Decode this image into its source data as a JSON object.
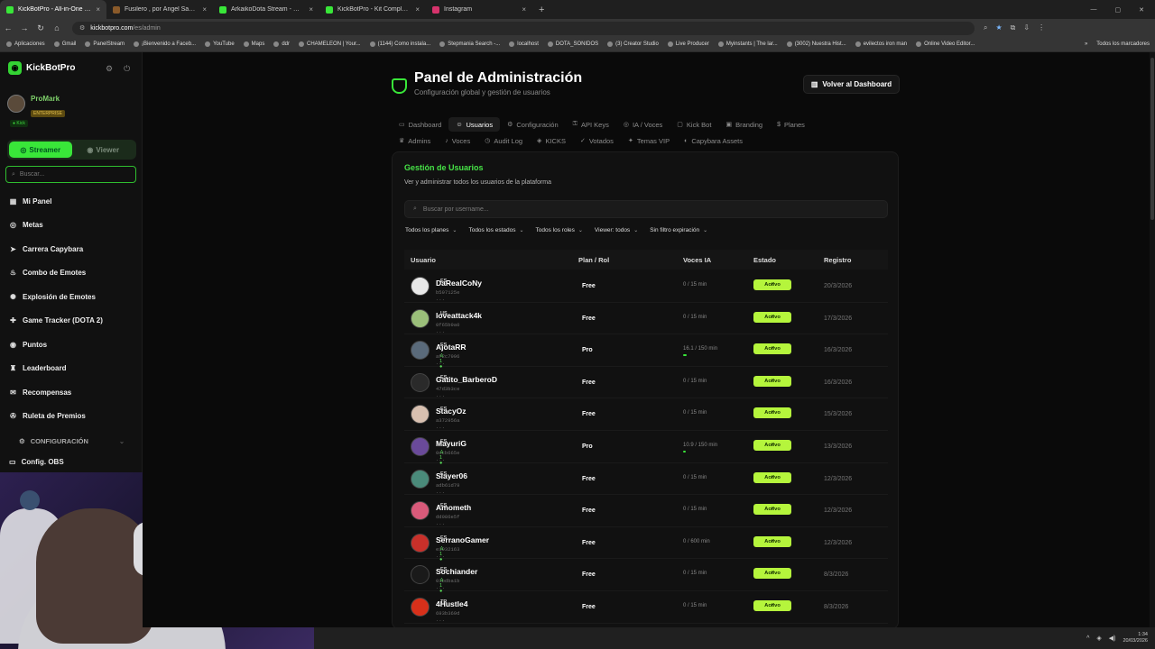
{
  "browser": {
    "tabs": [
      {
        "title": "KickBotPro - All-in-One Stream",
        "color": "#39e639",
        "active": true
      },
      {
        "title": "Fusilero , por Ángel Sacristán",
        "color": "#8a5a2a",
        "active": false
      },
      {
        "title": "ArkaikoDota Stream - Watch Li",
        "color": "#39e639",
        "active": false
      },
      {
        "title": "KickBotPro - Kit Completo de S",
        "color": "#39e639",
        "active": false
      },
      {
        "title": "Instagram",
        "color": "#d6336c",
        "active": false
      }
    ],
    "url_host": "kickbotpro.com",
    "url_path": "/es/admin",
    "bookmarks": [
      "Aplicaciones",
      "Gmail",
      "PanelStream",
      "¡Bienvenido a Faceb...",
      "YouTube",
      "Maps",
      "ddr",
      "CHAMELEON | Your...",
      "(1144) Como instala...",
      "Stepmania Search -...",
      "localhost",
      "DOTA_SONIDOS",
      "(3) Creator Studio",
      "Live Producer",
      "Myinstants | The lar...",
      "(3002) Nuestra Hist...",
      "evilectos iron man",
      "Online Video Editor..."
    ],
    "bookmarks_all": "Todos los marcadores"
  },
  "sidebar": {
    "brand": "KickBotPro",
    "user_name": "ProMark",
    "user_plan": "ENTERPRISE",
    "platform": "Kick",
    "mode_on": "Streamer",
    "mode_off": "Viewer",
    "search_placeholder": "Buscar...",
    "items": [
      {
        "label": "Mi Panel",
        "icon": "grid"
      },
      {
        "label": "Metas",
        "icon": "target"
      },
      {
        "label": "Carrera Capybara",
        "icon": "race"
      },
      {
        "label": "Combo de Emotes",
        "icon": "flame"
      },
      {
        "label": "Explosión de Emotes",
        "icon": "burst"
      },
      {
        "label": "Game Tracker (DOTA 2)",
        "icon": "gamepad"
      },
      {
        "label": "Puntos",
        "icon": "coin"
      },
      {
        "label": "Leaderboard",
        "icon": "trophy"
      },
      {
        "label": "Recompensas",
        "icon": "gift"
      },
      {
        "label": "Ruleta de Premios",
        "icon": "wheel"
      }
    ],
    "config_label": "CONFIGURACIÓN",
    "obs_label": "Config. OBS"
  },
  "page": {
    "title": "Panel de Administración",
    "subtitle": "Configuración global y gestión de usuarios",
    "back_button": "Volver al Dashboard",
    "tabs_row1": [
      {
        "label": "Dashboard",
        "icon": "▭",
        "active": false
      },
      {
        "label": "Usuarios",
        "icon": "☺",
        "active": true
      },
      {
        "label": "Configuración",
        "icon": "⚙",
        "active": false
      },
      {
        "label": "API Keys",
        "icon": "⚿",
        "active": false
      },
      {
        "label": "IA / Voces",
        "icon": "◎",
        "active": false
      },
      {
        "label": "Kick Bot",
        "icon": "▢",
        "active": false
      },
      {
        "label": "Branding",
        "icon": "▣",
        "active": false
      },
      {
        "label": "Planes",
        "icon": "$",
        "active": false
      }
    ],
    "tabs_row2": [
      {
        "label": "Admins",
        "icon": "♛",
        "active": false
      },
      {
        "label": "Voces",
        "icon": "♪",
        "active": false
      },
      {
        "label": "Audit Log",
        "icon": "◷",
        "active": false
      },
      {
        "label": "KICKS",
        "icon": "◈",
        "active": false
      },
      {
        "label": "Votados",
        "icon": "✓",
        "active": false
      },
      {
        "label": "Temas VIP",
        "icon": "✦",
        "active": false
      },
      {
        "label": "Capybara Assets",
        "icon": "◐",
        "active": false
      }
    ],
    "card_title": "Gestión de Usuarios",
    "card_subtitle": "Ver y administrar todos los usuarios de la plataforma",
    "search_placeholder": "Buscar por username...",
    "filters": [
      "Todos los planes",
      "Todos los estados",
      "Todos los roles",
      "Viewer: todos",
      "Sin filtro expiración"
    ],
    "columns": [
      "Usuario",
      "Plan / Rol",
      "Voces IA",
      "Estado",
      "Registro"
    ],
    "users": [
      {
        "name": "DaRealCoNy",
        "lang": "ES",
        "id": "b597125e ...",
        "badge": "",
        "plan": "Free",
        "voices": "0 / 15 min",
        "voice_fraction": 0,
        "status": "Activo",
        "date": "20/3/2026",
        "avatar": "#e8e8e8"
      },
      {
        "name": "loveattack4k",
        "lang": "US",
        "id": "0f65b9a0 ...",
        "badge": "",
        "plan": "Free",
        "voices": "0 / 15 min",
        "voice_fraction": 0,
        "status": "Activo",
        "date": "17/3/2026",
        "avatar": "#9bbf7a"
      },
      {
        "name": "AjotaRR",
        "lang": "ES",
        "id": "af2c7996 ...",
        "badge": "♙ 1 ●",
        "plan": "Pro",
        "voices": "16.1 / 150 min",
        "voice_fraction": 0.107,
        "status": "Activo",
        "date": "16/3/2026",
        "avatar": "#5a6a7a"
      },
      {
        "name": "Gatito_BarberoD",
        "lang": "ES",
        "id": "47d3b3ce ...",
        "badge": "",
        "plan": "Free",
        "voices": "0 / 15 min",
        "voice_fraction": 0,
        "status": "Activo",
        "date": "16/3/2026",
        "avatar": "#2a2a2a"
      },
      {
        "name": "StacyOz",
        "lang": "ES",
        "id": "a372956a ...",
        "badge": "",
        "plan": "Free",
        "voices": "0 / 15 min",
        "voice_fraction": 0,
        "status": "Activo",
        "date": "15/3/2026",
        "avatar": "#d8c0b0"
      },
      {
        "name": "MayuriG",
        "lang": "ES",
        "id": "0ccb665e ...",
        "badge": "♙ 1 ●",
        "plan": "Pro",
        "voices": "10.9 / 150 min",
        "voice_fraction": 0.073,
        "status": "Activo",
        "date": "13/3/2026",
        "avatar": "#6a4a9a"
      },
      {
        "name": "Slayer06",
        "lang": "ES",
        "id": "adb61d79 ...",
        "badge": "",
        "plan": "Free",
        "voices": "0 / 15 min",
        "voice_fraction": 0,
        "status": "Activo",
        "date": "12/3/2026",
        "avatar": "#4a8a7a"
      },
      {
        "name": "Amometh",
        "lang": "ES",
        "id": "dd086e5f ...",
        "badge": "",
        "plan": "Free",
        "voices": "0 / 15 min",
        "voice_fraction": 0,
        "status": "Activo",
        "date": "12/3/2026",
        "avatar": "#d85a7a"
      },
      {
        "name": "SerranoGamer",
        "lang": "ES",
        "id": "e1932163 ...",
        "badge": "♙ 1 ●",
        "plan": "Free",
        "voices": "0 / 600 min",
        "voice_fraction": 0,
        "status": "Activo",
        "date": "12/3/2026",
        "avatar": "#c8302a"
      },
      {
        "name": "Sochiander",
        "lang": "ES",
        "id": "01bdba1b ...",
        "badge": "♙ 1 ●",
        "plan": "Free",
        "voices": "0 / 15 min",
        "voice_fraction": 0,
        "status": "Activo",
        "date": "8/3/2026",
        "avatar": "#1a1a1a"
      },
      {
        "name": "4Hustle4",
        "lang": "TR",
        "id": "693b369d ...",
        "badge": "",
        "plan": "Free",
        "voices": "0 / 15 min",
        "voice_fraction": 0,
        "status": "Activo",
        "date": "8/3/2026",
        "avatar": "#d8301a"
      }
    ]
  },
  "taskbar": {
    "time": "1:34",
    "date": "20/03/2026"
  }
}
